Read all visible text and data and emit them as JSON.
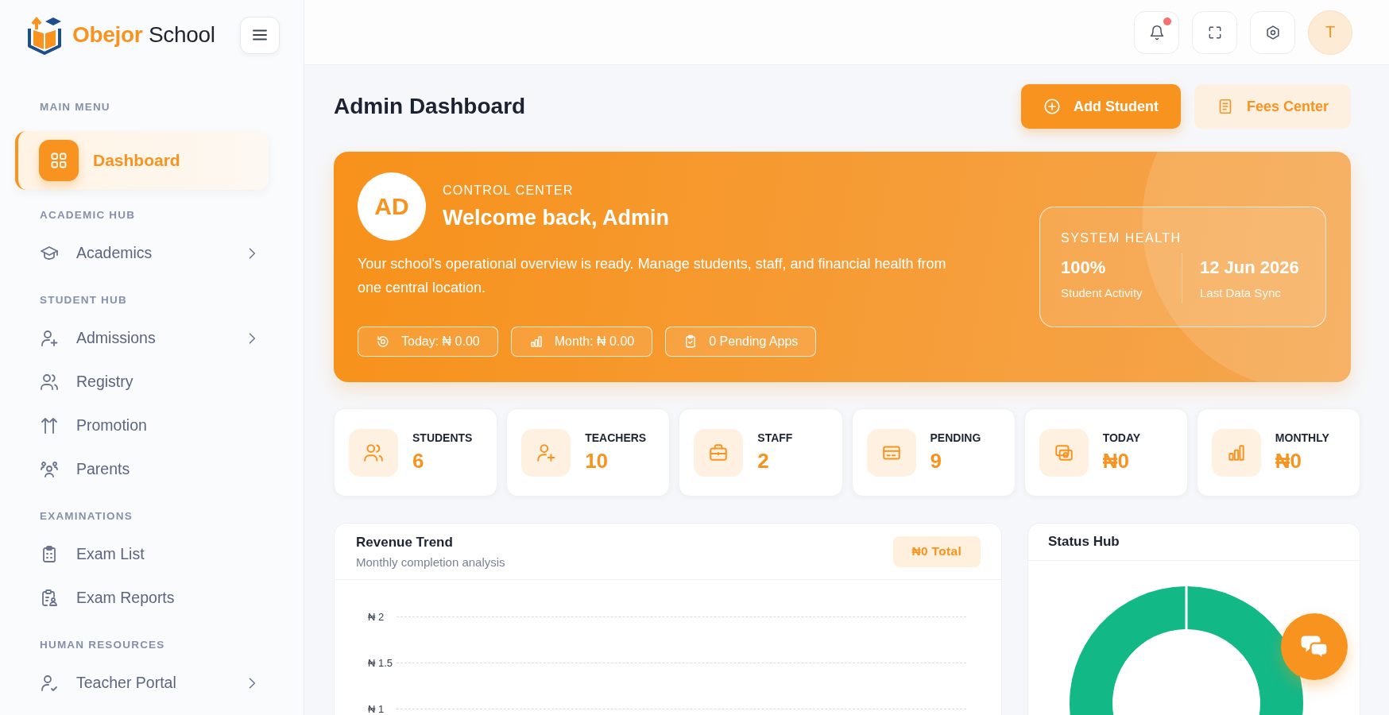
{
  "sidebar": {
    "logo": {
      "name": "Obejor",
      "suffix": "School"
    },
    "sections": [
      {
        "heading": "MAIN MENU",
        "items": [
          {
            "label": "Dashboard",
            "selected": true,
            "has_submenu": false
          }
        ]
      },
      {
        "heading": "ACADEMIC HUB",
        "items": [
          {
            "label": "Academics",
            "selected": false,
            "has_submenu": true
          }
        ]
      },
      {
        "heading": "STUDENT HUB",
        "items": [
          {
            "label": "Admissions",
            "selected": false,
            "has_submenu": true
          },
          {
            "label": "Registry",
            "selected": false,
            "has_submenu": false
          },
          {
            "label": "Promotion",
            "selected": false,
            "has_submenu": false
          },
          {
            "label": "Parents",
            "selected": false,
            "has_submenu": false
          }
        ]
      },
      {
        "heading": "EXAMINATIONS",
        "items": [
          {
            "label": "Exam List",
            "selected": false,
            "has_submenu": false
          },
          {
            "label": "Exam Reports",
            "selected": false,
            "has_submenu": false
          }
        ]
      },
      {
        "heading": "HUMAN RESOURCES",
        "items": [
          {
            "label": "Teacher Portal",
            "selected": false,
            "has_submenu": true
          }
        ]
      }
    ]
  },
  "header": {
    "notifications_unread": true,
    "avatar": "T"
  },
  "page": {
    "title": "Admin Dashboard",
    "actions": [
      {
        "label": "Add Student",
        "kind": "primary"
      },
      {
        "label": "Fees Center",
        "kind": "secondary"
      }
    ]
  },
  "banner": {
    "avatar": "AD",
    "eyebrow": "CONTROL CENTER",
    "title": "Welcome back, Admin",
    "description": "Your school's operational overview is ready. Manage students, staff, and financial health from one central location.",
    "pills": [
      "Today: ₦ 0.00",
      "Month: ₦ 0.00",
      "0 Pending Apps"
    ],
    "health": {
      "heading": "SYSTEM HEALTH",
      "metrics": [
        {
          "value": "100%",
          "label": "Student Activity"
        },
        {
          "value": "12 Jun 2026",
          "label": "Last Data Sync"
        }
      ]
    }
  },
  "stats": [
    {
      "label": "STUDENTS",
      "value": "6"
    },
    {
      "label": "TEACHERS",
      "value": "10"
    },
    {
      "label": "STAFF",
      "value": "2"
    },
    {
      "label": "PENDING",
      "value": "9"
    },
    {
      "label": "TODAY",
      "value": "₦0"
    },
    {
      "label": "MONTHLY",
      "value": "₦0"
    }
  ],
  "revenue_trend": {
    "title": "Revenue Trend",
    "subtitle": "Monthly completion analysis",
    "total": "₦0 Total",
    "y_axis_labels": [
      "₦ 2",
      "₦ 1.5",
      "₦ 1"
    ]
  },
  "status_hub": {
    "title": "Status Hub"
  }
}
